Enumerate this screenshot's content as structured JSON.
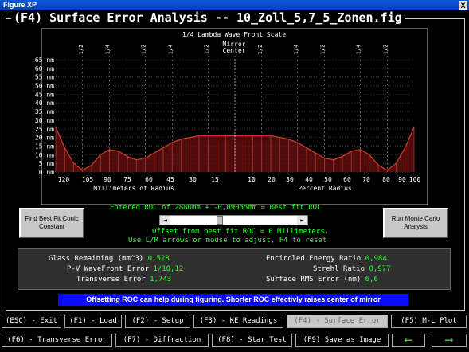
{
  "window": {
    "title": "Figure XP",
    "close_label": "X"
  },
  "heading": "(F4) Surface Error Analysis -- 10_Zoll_5,7_5_Zonen.fig",
  "chart_data": {
    "type": "area",
    "title": "1/4 Lambda Wave Front Scale",
    "center_label_top": "Mirror",
    "center_label_bottom": "Center",
    "y_unit": "nm",
    "ylim": [
      0,
      65
    ],
    "y_ticks": [
      65,
      60,
      55,
      50,
      45,
      40,
      35,
      30,
      25,
      20,
      15,
      10,
      5,
      0
    ],
    "top_markers": [
      "1/2",
      "1/4",
      "1/2",
      "1/4",
      "1/2",
      "1/2",
      "1/4",
      "1/2",
      "1/4",
      "1/2"
    ],
    "x_ticks_left": [
      "120",
      "105",
      "90",
      "75",
      "60",
      "45",
      "30",
      "15"
    ],
    "x_ticks_right": [
      "10",
      "20",
      "30",
      "40",
      "50",
      "60",
      "70",
      "80",
      "90",
      "100"
    ],
    "xlabel_left": "Millimeters of Radius",
    "xlabel_right": "Percent Radius",
    "x": [
      -100,
      -95,
      -90,
      -85,
      -80,
      -75,
      -70,
      -65,
      -60,
      -55,
      -50,
      -45,
      -40,
      -35,
      -30,
      -25,
      -20,
      -15,
      -10,
      -5,
      0,
      5,
      10,
      15,
      20,
      25,
      30,
      35,
      40,
      45,
      50,
      55,
      60,
      65,
      70,
      75,
      80,
      85,
      90,
      95,
      100
    ],
    "y": [
      26,
      14,
      5,
      1,
      4,
      10,
      13,
      12,
      9,
      7,
      8,
      11,
      14,
      17,
      19,
      20,
      21,
      21,
      21,
      21,
      21,
      21,
      21,
      21,
      21,
      20,
      19,
      17,
      14,
      11,
      8,
      7,
      9,
      12,
      13,
      10,
      4,
      1,
      5,
      14,
      26
    ],
    "grid": true
  },
  "buttons": {
    "best_fit_conic": "Find Best Fit Conic Constant",
    "monte_carlo": "Run Monte Carlo Analysis"
  },
  "roc": {
    "entered": "Entered ROC of 2880mm + -0,09055mm = Best fit ROC",
    "offset": "Offset from best fit ROC = 0 Millimeters.",
    "instructions": "Use L/R arrows or mouse to adjust, F4 to reset",
    "slider_left": "◄",
    "slider_right": "►",
    "slider_position": 0.38
  },
  "stats": {
    "glass_remaining_label": "Glass Remaining (mm^3)",
    "glass_remaining": "0,528",
    "pv_label": "P-V WaveFront Error",
    "pv": "1/10,12",
    "transverse_label": "Transverse Error",
    "transverse": "1,743",
    "encircled_label": "Encircled Energy Ratio",
    "encircled": "0,984",
    "strehl_label": "Strehl Ratio",
    "strehl": "0,977",
    "rms_label": "Surface RMS Error (nm)",
    "rms": "6,6"
  },
  "banner": "Offsetting ROC can help during figuring. Shorter ROC effectivly raises center of mirror",
  "fkeys_row1": [
    "(ESC) - Exit",
    "(F1) - Load",
    "(F2) - Setup",
    "(F3) - KE Readings",
    "(F4) - Surface Error",
    "(F5) M-L Plot"
  ],
  "fkeys_row2": [
    "(F6) - Transverse Error",
    "(F7) - Diffraction",
    "(F8) - Star Test",
    "(F9) Save as Image"
  ],
  "nav": {
    "prev": "⟵",
    "next": "⟶"
  },
  "colors": {
    "accent_green": "#33ff33",
    "curve_red": "#c0392b",
    "fill_red": "#6b1010",
    "banner_blue": "#0a0aff"
  }
}
